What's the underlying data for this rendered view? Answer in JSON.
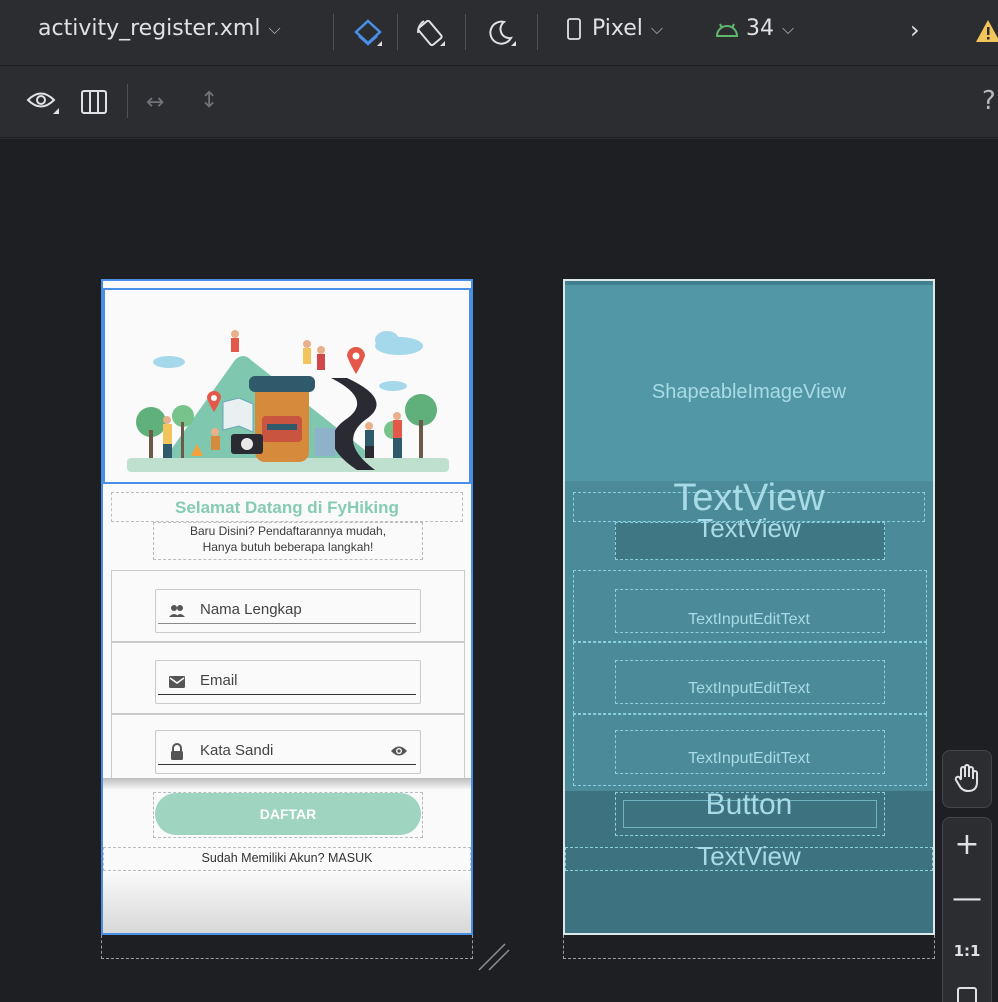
{
  "toolbar": {
    "file_name": "activity_register.xml",
    "device": "Pixel",
    "api_level": "34",
    "more": "›",
    "help": "?"
  },
  "design": {
    "title": "Selamat Datang di FyHiking",
    "subtitle_line1": "Baru Disini? Pendaftarannya mudah,",
    "subtitle_line2": "Hanya butuh beberapa langkah!",
    "name_hint": "Nama Lengkap",
    "email_hint": "Email",
    "password_hint": "Kata Sandi",
    "register_button": "DAFTAR",
    "login_link": "Sudah Memiliki Akun? MASUK"
  },
  "blueprint": {
    "image_view": "ShapeableImageView",
    "text_view_1": "TextView",
    "text_view_2": "TextView",
    "input_1": "TextInputEditText",
    "input_2": "TextInputEditText",
    "input_3": "TextInputEditText",
    "button": "Button",
    "text_view_3": "TextView"
  },
  "zoom": {
    "reset": "1:1"
  },
  "colors": {
    "accent": "#4a8fe7",
    "title_green": "#86cbb3",
    "button_green": "#9fd4c1",
    "blueprint": "#427f8f",
    "api_green": "#5fb86b",
    "warning": "#f2c55c"
  }
}
